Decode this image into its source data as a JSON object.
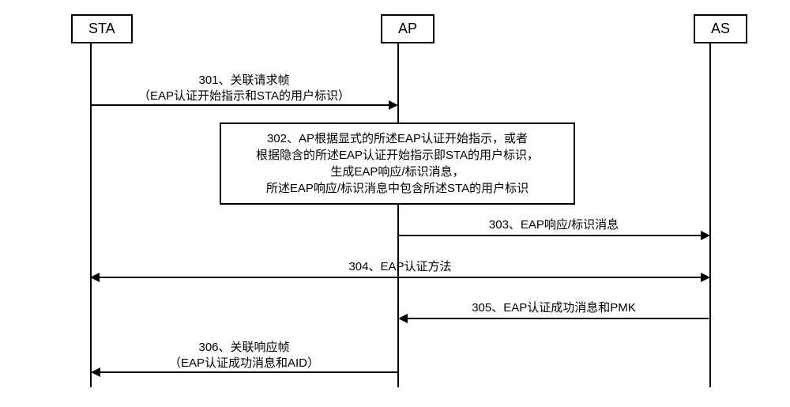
{
  "participants": {
    "sta": "STA",
    "ap": "AP",
    "as": "AS"
  },
  "messages": {
    "m301_title": "301、关联请求帧",
    "m301_sub": "（EAP认证开始指示和STA的用户标识）",
    "m302_line1": "302、AP根据显式的所述EAP认证开始指示，或者",
    "m302_line2": "根据隐含的所述EAP认证开始指示即STA的用户标识，",
    "m302_line3": "生成EAP响应/标识消息，",
    "m302_line4": "所述EAP响应/标识消息中包含所述STA的用户标识",
    "m303": "303、EAP响应/标识消息",
    "m304": "304、EAP认证方法",
    "m305": "305、EAP认证成功消息和PMK",
    "m306_title": "306、关联响应帧",
    "m306_sub": "（EAP认证成功消息和AID）"
  },
  "chart_data": {
    "type": "sequence-diagram",
    "participants": [
      "STA",
      "AP",
      "AS"
    ],
    "steps": [
      {
        "id": "301",
        "from": "STA",
        "to": "AP",
        "label": "关联请求帧",
        "detail": "EAP认证开始指示和STA的用户标识"
      },
      {
        "id": "302",
        "at": "AP",
        "type": "process",
        "label": "AP根据显式的所述EAP认证开始指示，或者根据隐含的所述EAP认证开始指示即STA的用户标识，生成EAP响应/标识消息，所述EAP响应/标识消息中包含所述STA的用户标识"
      },
      {
        "id": "303",
        "from": "AP",
        "to": "AS",
        "label": "EAP响应/标识消息"
      },
      {
        "id": "304",
        "from": "STA",
        "to": "AS",
        "bidirectional": true,
        "label": "EAP认证方法"
      },
      {
        "id": "305",
        "from": "AS",
        "to": "AP",
        "label": "EAP认证成功消息和PMK"
      },
      {
        "id": "306",
        "from": "AP",
        "to": "STA",
        "label": "关联响应帧",
        "detail": "EAP认证成功消息和AID"
      }
    ]
  }
}
